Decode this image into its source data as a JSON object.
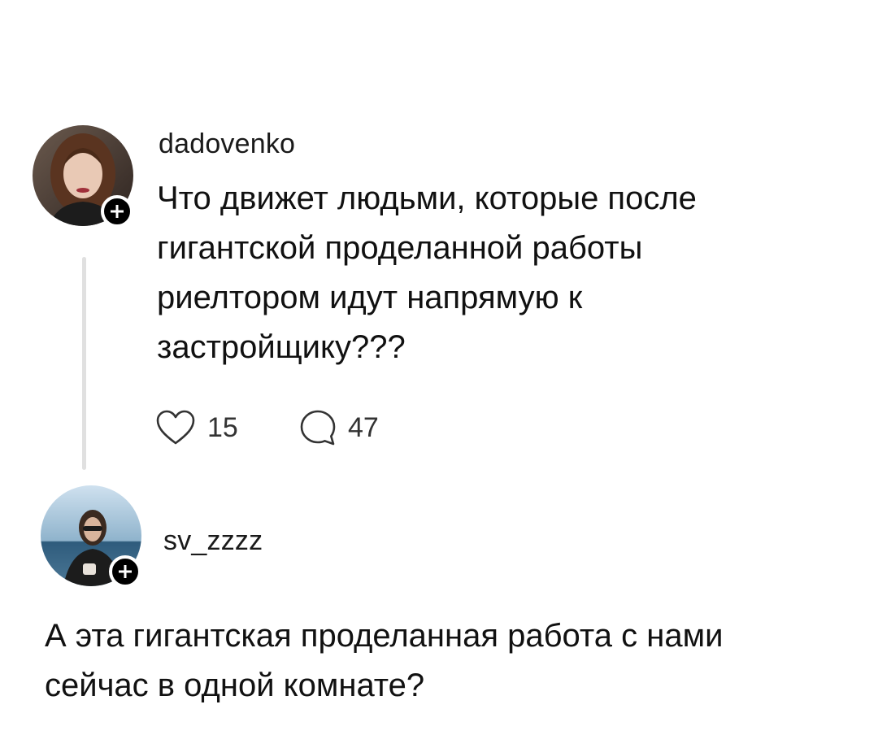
{
  "post": {
    "author": {
      "username": "dadovenko",
      "avatar_icon": "avatar-photo",
      "follow_icon": "plus-icon"
    },
    "text_lines": [
      "Что движет людьми, которые после",
      "гигантской проделанной работы",
      "риелтором идут напрямую к",
      "застройщику???"
    ],
    "actions": {
      "like_count": "15",
      "reply_count": "47",
      "like_icon": "heart-icon",
      "reply_icon": "comment-icon"
    }
  },
  "reply": {
    "author": {
      "username": "sv_zzzz",
      "avatar_icon": "avatar-photo",
      "follow_icon": "plus-icon"
    },
    "text_lines": [
      "А эта гигантская проделанная работа с нами",
      "сейчас в одной комнате?"
    ]
  },
  "colors": {
    "background": "#ffffff",
    "text": "#111111",
    "badge": "#000000",
    "thread_line": "#e0e0e0"
  }
}
